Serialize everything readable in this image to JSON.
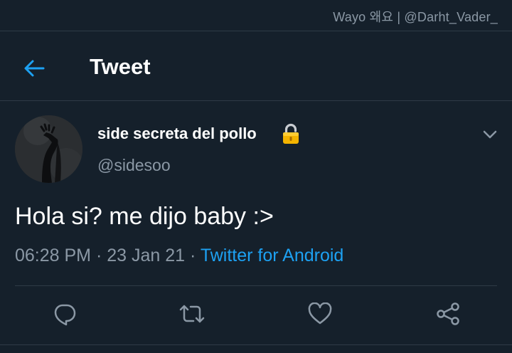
{
  "watermark": "Wayo 왜요 | @Darht_Vader_",
  "header": {
    "title": "Tweet",
    "back_icon": "arrow-left-icon"
  },
  "tweet": {
    "display_name": "side secreta del pollo",
    "protected_icon": "lock-icon",
    "username": "@sidesoo",
    "text": "Hola si? me dijo baby :>",
    "time": "06:28 PM",
    "date": "23 Jan 21",
    "separator": "·",
    "source": "Twitter for Android"
  },
  "actions": [
    {
      "name": "reply",
      "icon": "reply-icon"
    },
    {
      "name": "retweet",
      "icon": "retweet-icon"
    },
    {
      "name": "like",
      "icon": "heart-icon"
    },
    {
      "name": "share",
      "icon": "share-icon"
    }
  ],
  "colors": {
    "background": "#15202b",
    "accent": "#1da1f2",
    "secondary_text": "#8b98a5",
    "divider": "#2f3b47"
  }
}
